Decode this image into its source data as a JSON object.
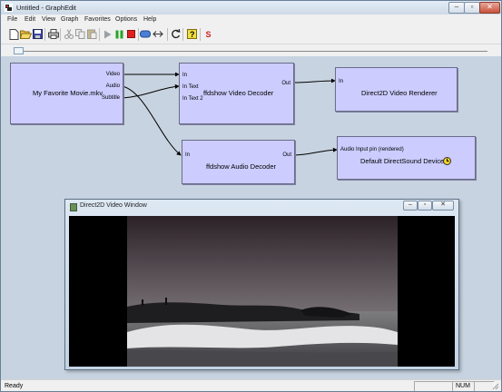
{
  "window": {
    "title": "Untitled - GraphEdit",
    "icon": "graphedit-app-icon"
  },
  "window_buttons": [
    "minimize",
    "maximize",
    "close"
  ],
  "menu": [
    {
      "label": "File"
    },
    {
      "label": "Edit"
    },
    {
      "label": "View"
    },
    {
      "label": "Graph"
    },
    {
      "label": "Favorites"
    },
    {
      "label": "Options"
    },
    {
      "label": "Help"
    }
  ],
  "toolbar": {
    "buttons": [
      "new-icon",
      "open-icon",
      "save-icon",
      "print-icon",
      "cut-icon",
      "copy-icon",
      "paste-icon",
      "play-icon",
      "pause-icon",
      "stop-icon",
      "frame-step-icon",
      "seek-icon",
      "refresh-icon",
      "help-icon",
      "sync-icon"
    ],
    "sync_label": "S",
    "help_label": "?"
  },
  "filters": {
    "source": {
      "name": "My Favorite Movie.mkv",
      "pins_out": [
        "Video",
        "Audio",
        "Subtitle"
      ]
    },
    "video_decoder": {
      "name": "ffdshow Video Decoder",
      "pins_in": [
        "In",
        "In Text",
        "In Text 2"
      ],
      "pin_out": "Out"
    },
    "video_renderer": {
      "name": "Direct2D Video Renderer",
      "pin_in": "In"
    },
    "audio_decoder": {
      "name": "ffdshow Audio Decoder",
      "pin_in": "In",
      "pin_out": "Out"
    },
    "audio_renderer": {
      "name": "Default DirectSound Device",
      "pin_in": "Audio Input pin (rendered)",
      "clock_icon": "reference-clock-icon"
    }
  },
  "video_window": {
    "title": "Direct2D Video Window"
  },
  "status": {
    "text": "Ready",
    "num": "NUM"
  },
  "colors": {
    "filter_fill": "#ccccff",
    "canvas": "#c7d3e0",
    "accent_title": "#dde8f3"
  }
}
